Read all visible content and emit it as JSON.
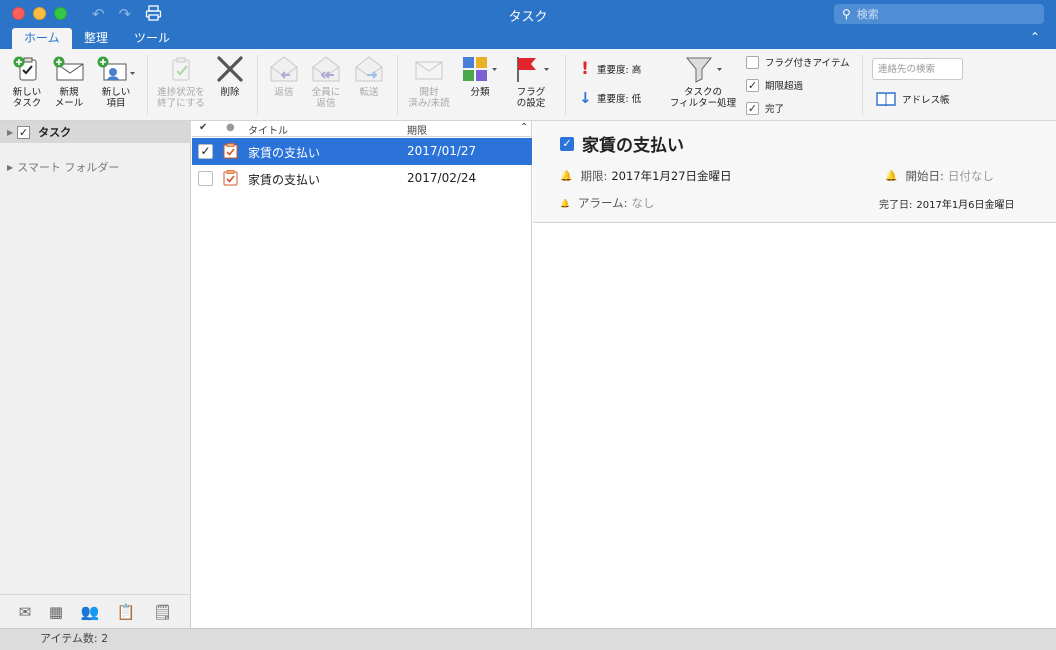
{
  "window": {
    "title": "タスク"
  },
  "search": {
    "placeholder": "検索"
  },
  "tabs": [
    {
      "label": "ホーム"
    },
    {
      "label": "整理"
    },
    {
      "label": "ツール"
    }
  ],
  "ribbon": {
    "new_task": "新しい\nタスク",
    "new_mail": "新規\nメール",
    "new_item": "新しい\n項目",
    "mark_complete": "進捗状況を\n終了にする",
    "delete": "削除",
    "reply": "返信",
    "reply_all": "全員に\n返信",
    "forward": "転送",
    "read_unread": "開封\n済み/未読",
    "categorize": "分類",
    "flag": "フラグ\nの設定",
    "priority_high": "重要度: 高",
    "priority_low": "重要度: 低",
    "filter": "タスクの\nフィルター処理",
    "flagged_items": "フラグ付きアイテム",
    "overdue": "期限超過",
    "completed": "完了",
    "contact_search_placeholder": "連絡先の検索",
    "address_book": "アドレス帳"
  },
  "sidebar": {
    "items": [
      {
        "label": "タスク",
        "checked": true
      },
      {
        "label": "スマート フォルダー"
      }
    ]
  },
  "list": {
    "columns": {
      "title": "タイトル",
      "due": "期限"
    },
    "rows": [
      {
        "title": "家賃の支払い",
        "due": "2017/01/27",
        "completed": true,
        "selected": true
      },
      {
        "title": "家賃の支払い",
        "due": "2017/02/24",
        "completed": false,
        "selected": false
      }
    ]
  },
  "detail": {
    "title": "家賃の支払い",
    "due_label": "期限:",
    "due_value": "2017年1月27日金曜日",
    "start_label": "開始日:",
    "start_value": "日付なし",
    "alarm_label": "アラーム:",
    "alarm_value": "なし",
    "completed_label": "完了日:",
    "completed_value": "2017年1月6日金曜日"
  },
  "status": {
    "item_count": "アイテム数: 2"
  },
  "colors": {
    "accent": "#2b74c7",
    "selection": "#2b73d8",
    "flag": "#e0242b"
  }
}
